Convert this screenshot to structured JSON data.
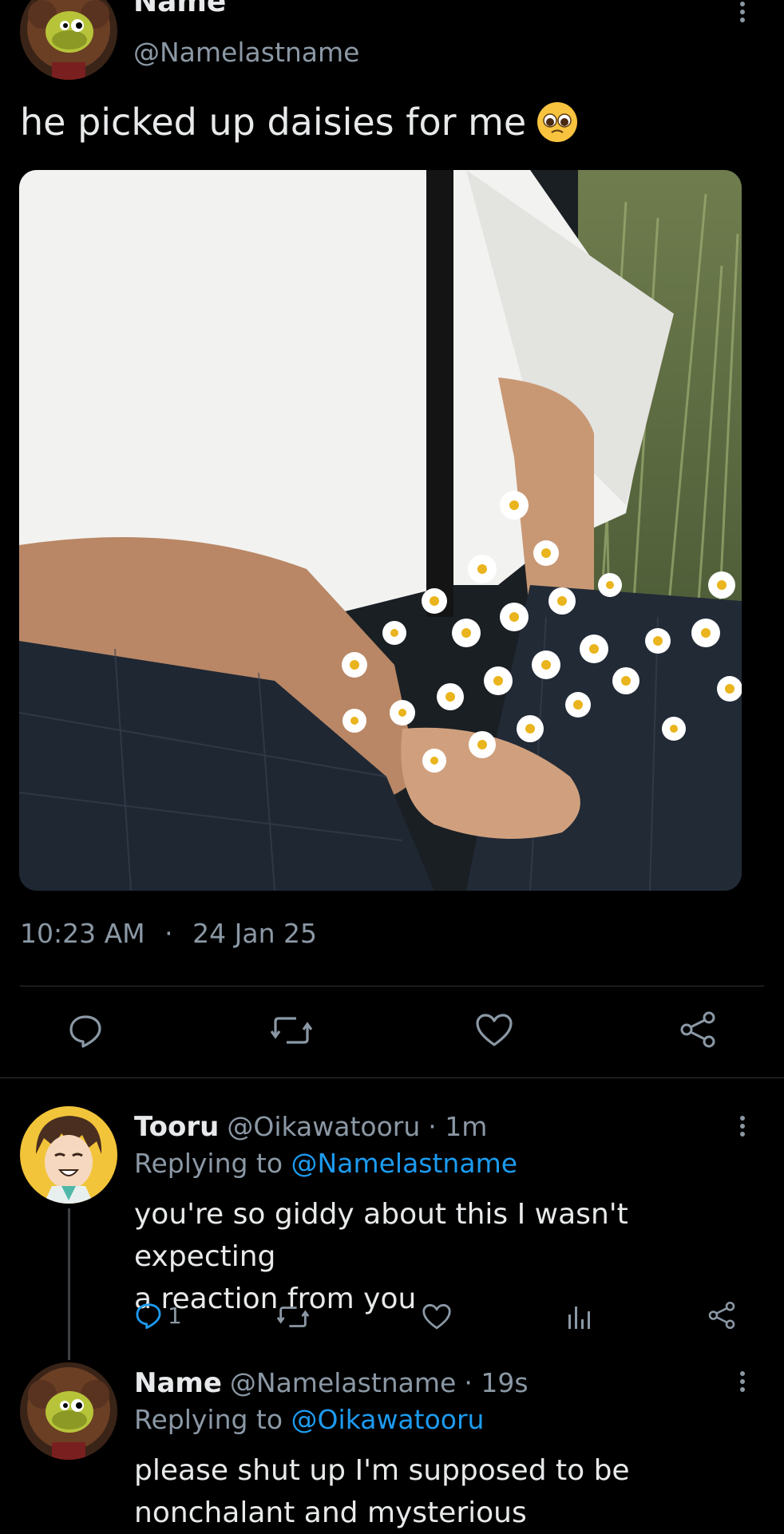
{
  "main_post": {
    "display_name": "Name",
    "handle": "@Namelastname",
    "text": "he picked up daisies for me",
    "emoji_icon": "pleading-face-icon",
    "time": "10:23 AM",
    "separator": "·",
    "date": "24 Jan 25",
    "actions": [
      "reply-icon",
      "retweet-icon",
      "like-icon",
      "share-icon"
    ]
  },
  "replies": [
    {
      "display_name": "Tooru",
      "handle": "@Oikawatooru",
      "meta": "· 1m",
      "replying_label": "Replying to",
      "replying_to": "@Namelastname",
      "text_line1": "you're so giddy about this I wasn't expecting",
      "text_line2": "a reaction from you",
      "reply_count": "1",
      "actions": [
        "reply-icon",
        "retweet-icon",
        "like-icon",
        "analytics-icon",
        "share-icon"
      ]
    },
    {
      "display_name": "Name",
      "handle": "@Namelastname",
      "meta": "· 19s",
      "replying_label": "Replying to",
      "replying_to": "@Oikawatooru",
      "text_line1": "please shut up I'm supposed to be",
      "text_line2": "nonchalant and mysterious"
    }
  ],
  "colors": {
    "background": "#000000",
    "text": "#e7e9ea",
    "secondary": "#8b98a5",
    "link": "#1d9bf0",
    "divider": "#2f3336"
  }
}
